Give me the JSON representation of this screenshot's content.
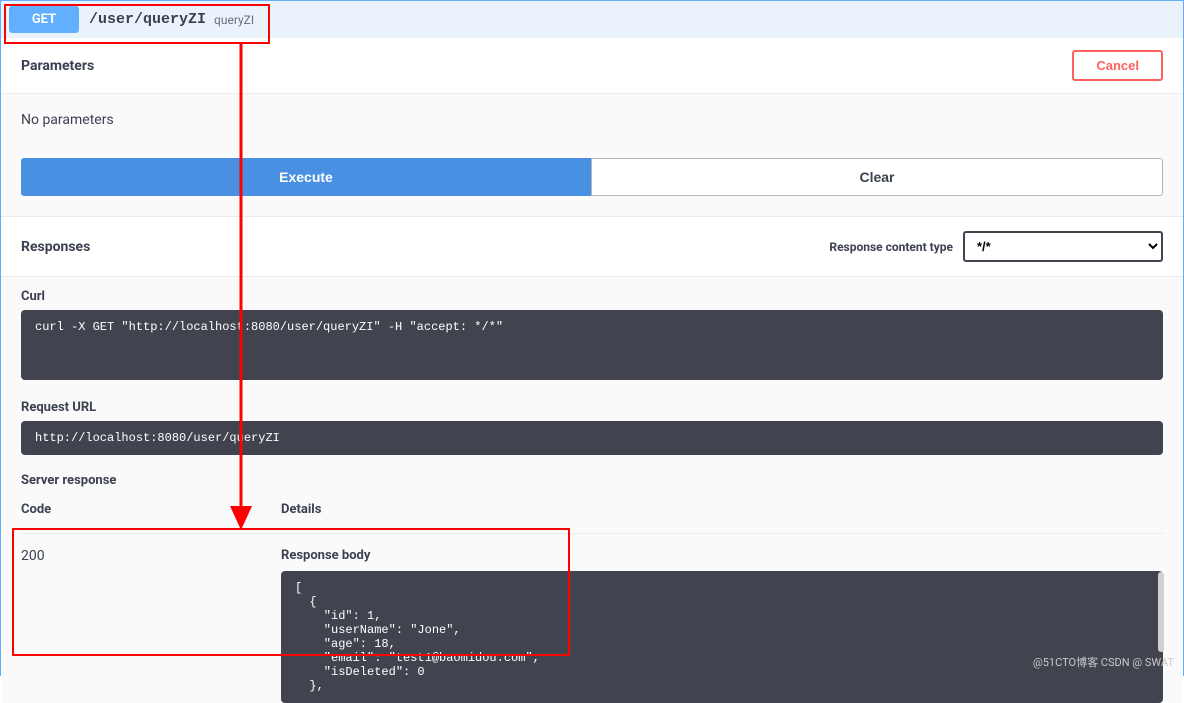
{
  "summary": {
    "method": "GET",
    "path": "/user/queryZI",
    "description": "queryZI"
  },
  "parameters": {
    "header": "Parameters",
    "cancel_label": "Cancel",
    "empty_text": "No parameters",
    "execute_label": "Execute",
    "clear_label": "Clear"
  },
  "responses": {
    "header": "Responses",
    "content_type_label": "Response content type",
    "content_type_value": "*/*"
  },
  "curl": {
    "label": "Curl",
    "command": "curl -X GET \"http://localhost:8080/user/queryZI\" -H \"accept: */*\""
  },
  "request_url": {
    "label": "Request URL",
    "value": "http://localhost:8080/user/queryZI"
  },
  "server_response": {
    "label": "Server response",
    "code_header": "Code",
    "details_header": "Details",
    "status_code": "200",
    "response_body_label": "Response body",
    "response_body": "[\n  {\n    \"id\": 1,\n    \"userName\": \"Jone\",\n    \"age\": 18,\n    \"email\": \"test1@baomidou.com\",\n    \"isDeleted\": 0\n  },"
  },
  "watermark": "@51CTO博客\nCSDN @ SWAT"
}
